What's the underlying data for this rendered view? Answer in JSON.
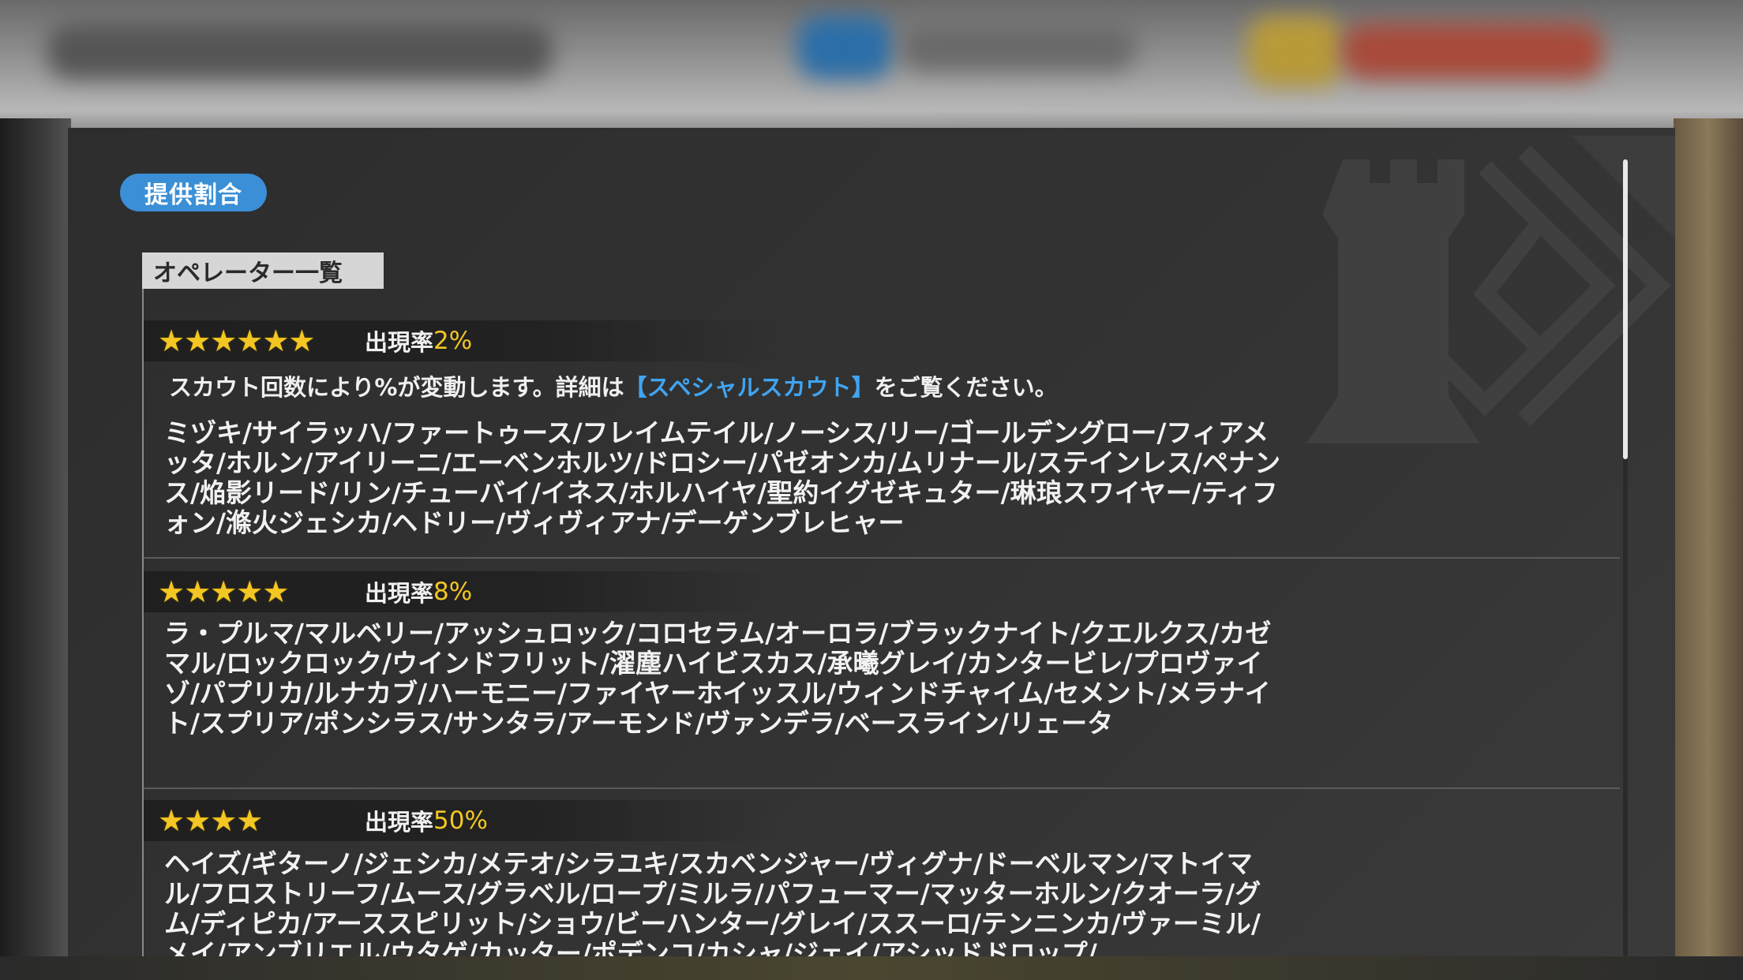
{
  "dialog": {
    "title": "提供割合",
    "list_label": "オペレーター一覧"
  },
  "tiers": [
    {
      "stars": 6,
      "rate_label": "出現率",
      "rate_value": "2%",
      "note_prefix": "スカウト回数により%が変動します。詳細は",
      "note_link": "【スペシャルスカウト】",
      "note_suffix": "をご覧ください。",
      "names": "ミヅキ/サイラッハ/ファートゥース/フレイムテイル/ノーシス/リー/ゴールデングロー/フィアメッタ/ホルン/アイリーニ/エーベンホルツ/ドロシー/パゼオンカ/ムリナール/ステインレス/ペナンス/焔影リード/リン/チューバイ/イネス/ホルハイヤ/聖約イグゼキュター/琳琅スワイヤー/ティフォン/滌火ジェシカ/ヘドリー/ヴィヴィアナ/デーゲンブレヒャー"
    },
    {
      "stars": 5,
      "rate_label": "出現率",
      "rate_value": "8%",
      "names": "ラ・プルマ/マルベリー/アッシュロック/コロセラム/オーロラ/ブラックナイト/クエルクス/カゼマル/ロックロック/ウインドフリット/濯塵ハイビスカス/承曦グレイ/カンタービレ/プロヴァイゾ/パプリカ/ルナカブ/ハーモニー/ファイヤーホイッスル/ウィンドチャイム/セメント/メラナイト/スプリア/ポンシラス/サンタラ/アーモンド/ヴァンデラ/ベースライン/リェータ"
    },
    {
      "stars": 4,
      "rate_label": "出現率",
      "rate_value": "50%",
      "names": "ヘイズ/ギターノ/ジェシカ/メテオ/シラユキ/スカベンジャー/ヴィグナ/ドーベルマン/マトイマル/フロストリーフ/ムース/グラベル/ロープ/ミルラ/パフューマー/マッターホルン/クオーラ/グム/ディピカ/アーススピリット/ショウ/ビーハンター/グレイ/ススーロ/テンニンカ/ヴァーミル/メイ/アンブリエル/ウタゲ/カッター/ポデンコ/カシャ/ジェイ/アシッドドロップ/"
    }
  ],
  "colors": {
    "accent_blue": "#3b8fd6",
    "star_gold": "#f3c623",
    "link_blue": "#41a4f0"
  },
  "icons": [
    "star-icon",
    "chess-rook-decoration"
  ]
}
